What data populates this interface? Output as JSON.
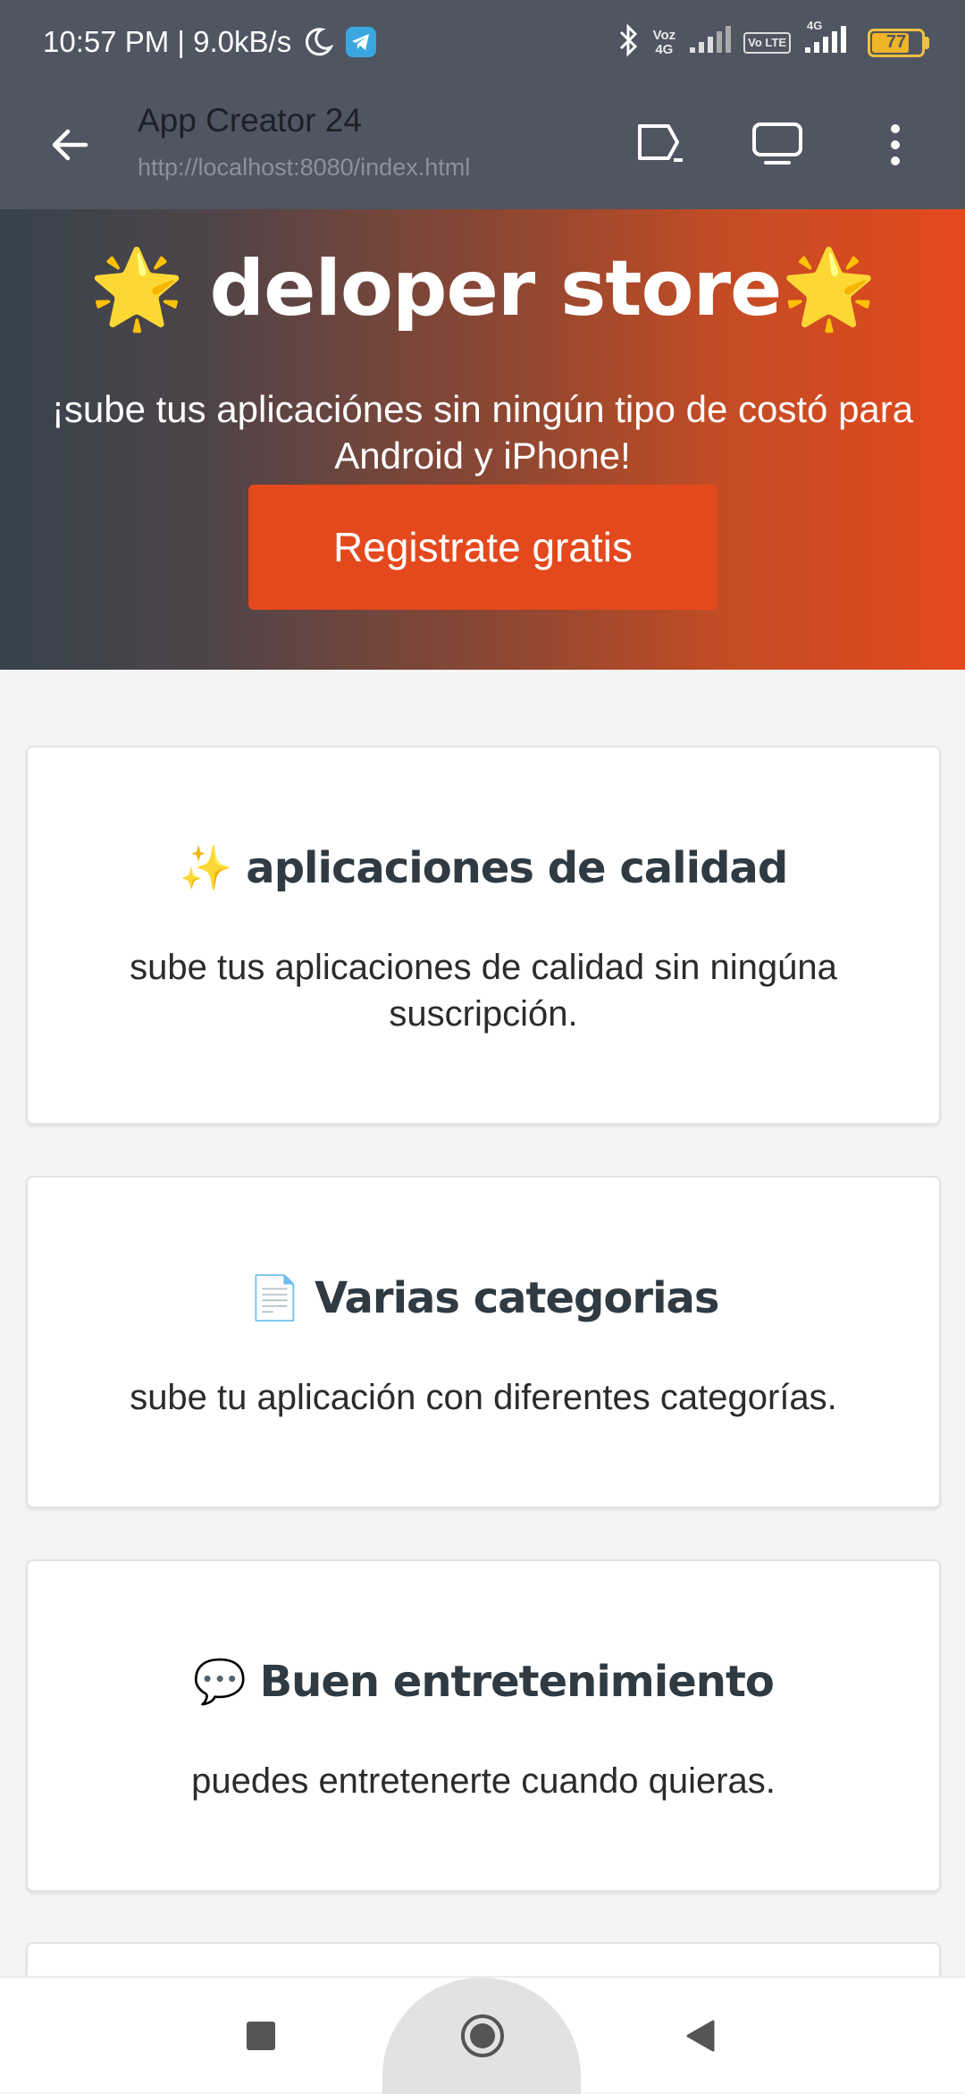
{
  "status_bar": {
    "time_speed": "10:57 PM | 9.0kB/s",
    "volte_label_1": "Voz",
    "volte_label_2": "4G",
    "lte_label": "Vo LTE",
    "signal2_label": "4G",
    "battery": "77",
    "battery_level": 0.77,
    "battery_color": "#f0b429"
  },
  "app_bar": {
    "title": "App Creator 24",
    "url": "http://localhost:8080/index.html"
  },
  "hero": {
    "title": "🌟 deloper store🌟",
    "subtitle": "¡sube tus aplicaciónes sin ningún tipo de costó para Android y iPhone!",
    "button_label": "Registrate gratis",
    "accent_color": "#e4491d"
  },
  "cards": [
    {
      "icon": "✨",
      "title": "aplicaciones de calidad",
      "text": "sube tus aplicaciones de calidad sin ningúna suscripción."
    },
    {
      "icon": "📄",
      "title": "Varias categorias",
      "text": "sube tu aplicación con diferentes categorías."
    },
    {
      "icon": "💬",
      "title": "Buen entretenimiento",
      "text": "puedes entretenerte cuando quieras."
    }
  ]
}
